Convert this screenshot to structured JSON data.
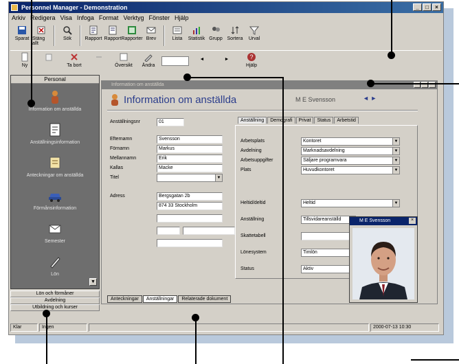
{
  "window": {
    "title": "Personnel Manager - Demonstration",
    "controls": [
      "_",
      "□",
      "×"
    ]
  },
  "menubar": [
    "Arkiv",
    "Redigera",
    "Visa",
    "Infoga",
    "Format",
    "Verktyg",
    "Fönster",
    "Hjälp"
  ],
  "toolbar_primary": [
    {
      "label": "Sparat",
      "icon": "save-icon"
    },
    {
      "label": "Stäng allt",
      "icon": "close-all-icon"
    },
    {
      "label": "Sök",
      "icon": "search-icon"
    },
    {
      "label": "Rapport",
      "icon": "report-icon"
    },
    {
      "label": "Rapport",
      "icon": "report-icon"
    },
    {
      "label": "Rapporter",
      "icon": "report-icon"
    },
    {
      "label": "Brev",
      "icon": "letter-icon"
    },
    {
      "label": "Lista",
      "icon": "list-icon"
    },
    {
      "label": "Statistik",
      "icon": "statistics-icon"
    },
    {
      "label": "Grupp",
      "icon": "group-icon"
    },
    {
      "label": "Sortera",
      "icon": "sort-icon"
    },
    {
      "label": "Urval",
      "icon": "filter-icon"
    }
  ],
  "toolbar_secondary": [
    {
      "label": "Ny",
      "icon": "new-icon"
    },
    {
      "label": "Ta bort",
      "icon": "delete-icon"
    },
    {
      "label": "Översikt",
      "icon": "overview-icon"
    },
    {
      "label": "Ändra",
      "icon": "edit-icon"
    },
    {
      "label": "Hjälp",
      "icon": "help-icon"
    }
  ],
  "sidebar": {
    "header": "Personal",
    "items": [
      {
        "label": "Information om anställda",
        "icon": "person-icon"
      },
      {
        "label": "Anställningsinformation",
        "icon": "document-icon"
      },
      {
        "label": "Anteckningar om anställda",
        "icon": "notes-icon"
      },
      {
        "label": "Förmånsinformation",
        "icon": "car-icon"
      },
      {
        "label": "Semester",
        "icon": "envelope-icon"
      },
      {
        "label": "Lön",
        "icon": "pen-icon"
      }
    ],
    "groups": [
      "Lön och förmåner",
      "Avdelning",
      "Utbildning och kurser"
    ]
  },
  "child_window": {
    "title": "Information om anställda",
    "heading": "Information om anställda",
    "user_name": "M E Svensson",
    "nav": "◄ ►",
    "left_fields": [
      {
        "label": "Anställningsnr",
        "value": "01"
      },
      {
        "label": "Efternamn",
        "value": "Svensson"
      },
      {
        "label": "Förnamn",
        "value": "Markus"
      },
      {
        "label": "Mellannamn",
        "value": "Erik"
      },
      {
        "label": "Kallas",
        "value": "Macke"
      },
      {
        "label": "Titel",
        "value": ""
      },
      {
        "label": "Adress",
        "value": "Bergsgatan 2b"
      },
      {
        "label": "",
        "value": "874 33 Stockholm"
      }
    ],
    "tabs": [
      "Anställning",
      "Demografi",
      "Privat",
      "Status",
      "Arbetstid"
    ],
    "right_fields": [
      {
        "label": "Arbetsplats",
        "value": "Kontoret"
      },
      {
        "label": "Avdelning",
        "value": "Marknadsavdelning"
      },
      {
        "label": "Arbetsuppgifter",
        "value": "Säljare programvara"
      },
      {
        "label": "Plats",
        "value": "Huvudkontoret"
      },
      {
        "label": "Heltid/deltid",
        "value": "Heltid"
      },
      {
        "label": "Anställning",
        "value": "Tillsvidareanställd"
      },
      {
        "label": "Skattetabell",
        "value": ""
      },
      {
        "label": "Lönesystem",
        "value": "Timlön"
      },
      {
        "label": "Status",
        "value": "Aktiv"
      }
    ],
    "bottom_tabs": [
      "Anteckningar",
      "Anställningar",
      "Relaterade dokument"
    ]
  },
  "photo_window": {
    "title": "M E Svensson"
  },
  "statusbar": [
    "Klar",
    "Ingen",
    "2000-07-13 10:30"
  ]
}
